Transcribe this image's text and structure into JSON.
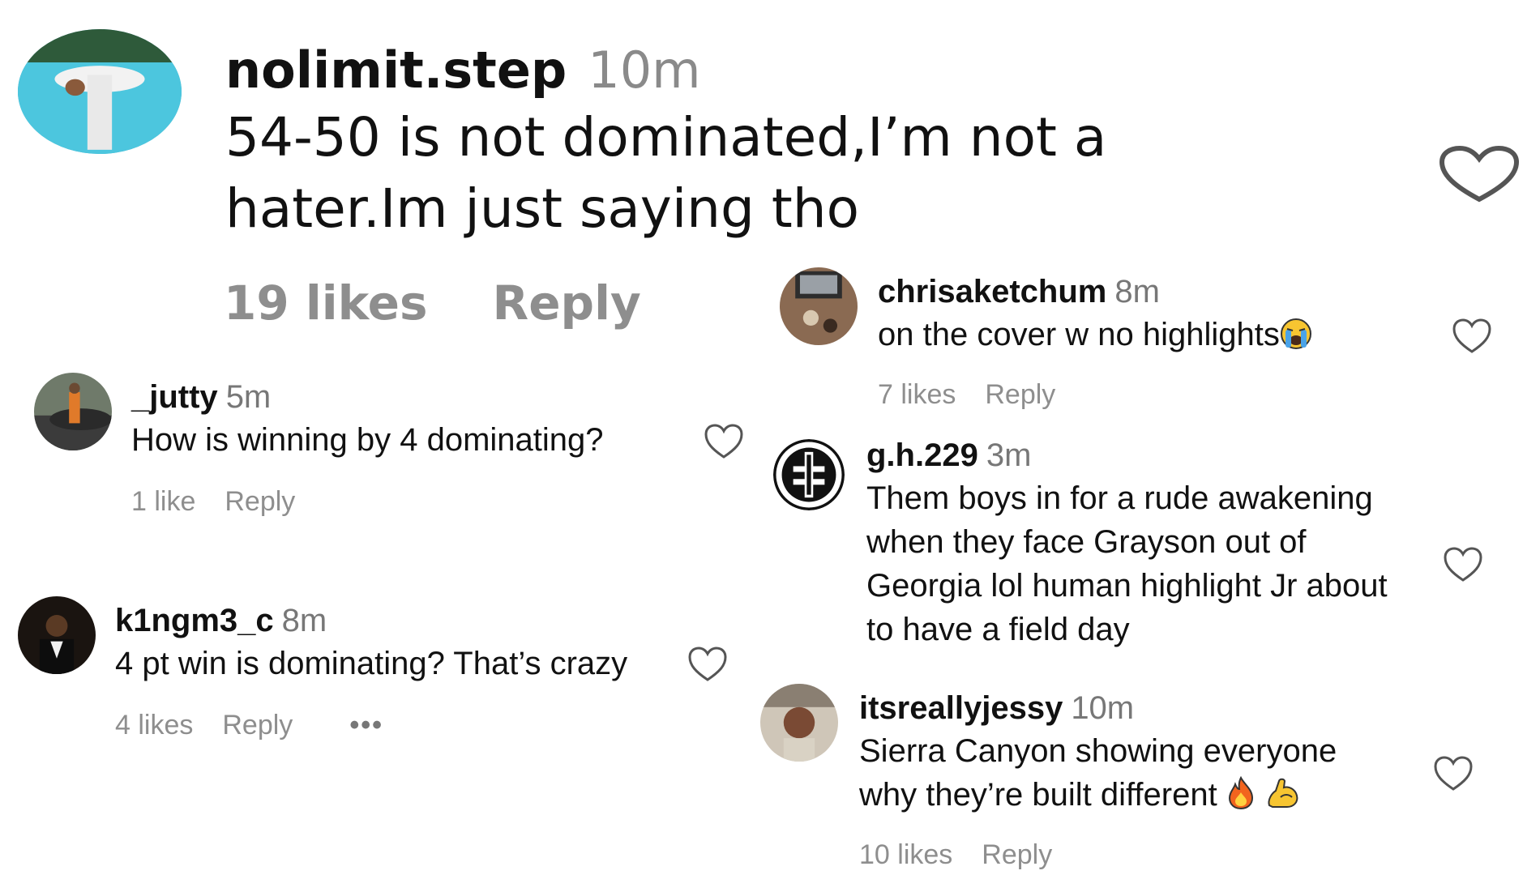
{
  "main_comment": {
    "username": "nolimit.step",
    "time": "10m",
    "text_line1": "54-50 is not dominated,I’m not a",
    "text_line2": "hater.Im just saying tho",
    "likes": "19 likes",
    "reply": "Reply"
  },
  "replies": {
    "jutty": {
      "username": "_jutty",
      "time": "5m",
      "text": "How is winning by 4 dominating?",
      "likes": "1 like",
      "reply": "Reply"
    },
    "kingm": {
      "username": "k1ngm3_c",
      "time": "8m",
      "text": "4 pt win is dominating? That’s crazy",
      "likes": "4 likes",
      "reply": "Reply",
      "more": "•••"
    },
    "chris": {
      "username": "chrisaketchum",
      "time": "8m",
      "text": "on the cover w no highlights",
      "likes": "7 likes",
      "reply": "Reply"
    },
    "gh": {
      "username": "g.h.229",
      "time": "3m",
      "text_line1": "Them boys in for a rude awakening",
      "text_line2": "when they face Grayson out of",
      "text_line3": "Georgia lol human highlight Jr about",
      "text_line4": "to have a field day"
    },
    "jessy": {
      "username": "itsreallyjessy",
      "time": "10m",
      "text_line1": "Sierra Canyon showing everyone",
      "text_line2": "why they’re built different",
      "likes": "10 likes",
      "reply": "Reply"
    }
  },
  "icons": {
    "heart": "heart-outline-icon",
    "crying_emoji": "loudly-crying-face-emoji",
    "fire_emoji": "fire-emoji",
    "muscle_emoji": "flexed-biceps-emoji"
  },
  "colors": {
    "text": "#111111",
    "secondary": "#8e8e8e",
    "heart_stroke": "#555555"
  }
}
